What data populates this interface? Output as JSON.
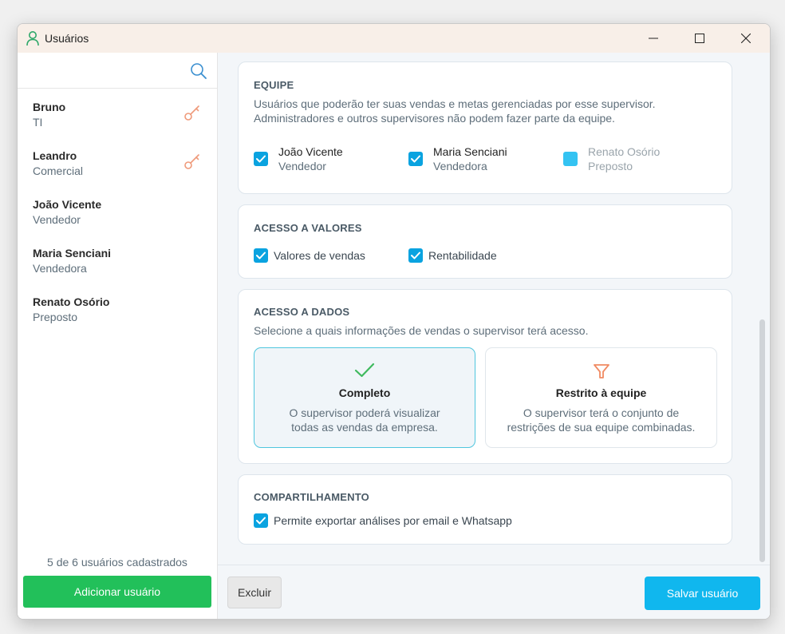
{
  "window": {
    "title": "Usuários",
    "accent": "#0aa3e0"
  },
  "sidebar": {
    "users": [
      {
        "name": "Bruno",
        "role": "TI",
        "has_key": true
      },
      {
        "name": "Leandro",
        "role": "Comercial",
        "has_key": true
      },
      {
        "name": "João Vicente",
        "role": "Vendedor",
        "has_key": false
      },
      {
        "name": "Maria Senciani",
        "role": "Vendedora",
        "has_key": false
      },
      {
        "name": "Renato Osório",
        "role": "Preposto",
        "has_key": false
      }
    ],
    "count_text": "5 de 6 usuários cadastrados",
    "add_button": "Adicionar usuário"
  },
  "equipe": {
    "title": "EQUIPE",
    "description": "Usuários que poderão ter suas vendas e metas gerenciadas por esse supervisor. Administradores e outros supervisores não podem fazer parte da equipe.",
    "members": [
      {
        "name": "João Vicente",
        "role": "Vendedor",
        "checked": true,
        "disabled": false
      },
      {
        "name": "Maria Senciani",
        "role": "Vendedora",
        "checked": true,
        "disabled": false
      },
      {
        "name": "Renato Osório",
        "role": "Preposto",
        "checked": false,
        "disabled": true
      }
    ]
  },
  "acesso_valores": {
    "title": "ACESSO A VALORES",
    "options": [
      {
        "label": "Valores de vendas",
        "checked": true
      },
      {
        "label": "Rentabilidade",
        "checked": true
      }
    ]
  },
  "acesso_dados": {
    "title": "ACESSO A DADOS",
    "description": "Selecione a quais informações de vendas o supervisor terá acesso.",
    "options": [
      {
        "title": "Completo",
        "line1": "O supervisor poderá visualizar",
        "line2": "todas as vendas da empresa.",
        "selected": true,
        "icon": "check-icon"
      },
      {
        "title": "Restrito à equipe",
        "line1": "O supervisor terá o conjunto de",
        "line2": "restrições de sua equipe combinadas.",
        "selected": false,
        "icon": "funnel-icon"
      }
    ]
  },
  "compartilhamento": {
    "title": "COMPARTILHAMENTO",
    "option": {
      "label": "Permite exportar análises por email e Whatsapp",
      "checked": true
    }
  },
  "footer": {
    "delete_button": "Excluir",
    "save_button": "Salvar usuário"
  }
}
